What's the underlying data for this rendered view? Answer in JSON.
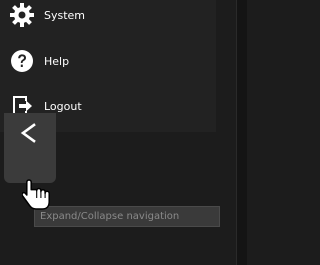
{
  "navigation": {
    "items": [
      {
        "label": "System",
        "icon": "gear-icon"
      },
      {
        "label": "Help",
        "icon": "question-icon"
      },
      {
        "label": "Logout",
        "icon": "logout-icon"
      }
    ],
    "collapse_button": {
      "icon": "chevron-left-icon"
    },
    "tooltip": "Expand/Collapse navigation"
  },
  "colors": {
    "background": "#1c1c1c",
    "menu_background": "#222222",
    "collapse_button": "#3b3b3b",
    "tooltip_background": "#3a3a3a",
    "text": "#ffffff"
  },
  "cursor": {
    "type": "hand-pointer-icon"
  }
}
